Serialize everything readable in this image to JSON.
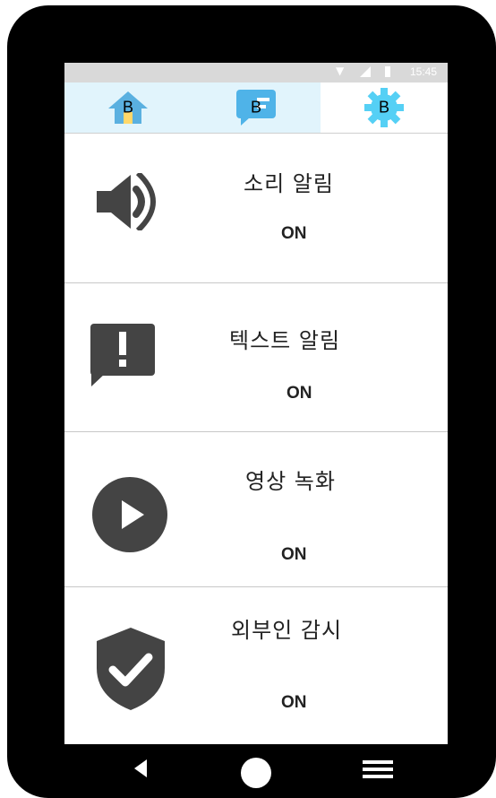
{
  "status_bar": {
    "time": "15:45",
    "wifi_icon": "wifi-icon",
    "signal_icon": "signal-icon",
    "battery_icon": "battery-icon"
  },
  "tabs": [
    {
      "icon": "home-icon",
      "badge": "B",
      "active": false
    },
    {
      "icon": "message-icon",
      "badge": "B",
      "active": false
    },
    {
      "icon": "gear-icon",
      "badge": "B",
      "active": true
    }
  ],
  "settings": [
    {
      "title": "소리 알림",
      "value": "ON",
      "icon": "speaker-icon"
    },
    {
      "title": "텍스트 알림",
      "value": "ON",
      "icon": "alert-message-icon"
    },
    {
      "title": "영상 녹화",
      "value": "ON",
      "icon": "play-icon"
    },
    {
      "title": "외부인 감시",
      "value": "ON",
      "icon": "shield-check-icon"
    }
  ],
  "nav": {
    "back_icon": "back-icon",
    "home_icon": "home-circle-icon",
    "menu_icon": "menu-icon"
  },
  "colors": {
    "tab_bg": "#e1f4fc",
    "home_icon": "#5ab0e0",
    "message_icon": "#4fb3e8",
    "gear_icon": "#55d0f5",
    "icon_dark": "#444444",
    "device": "#000000"
  }
}
